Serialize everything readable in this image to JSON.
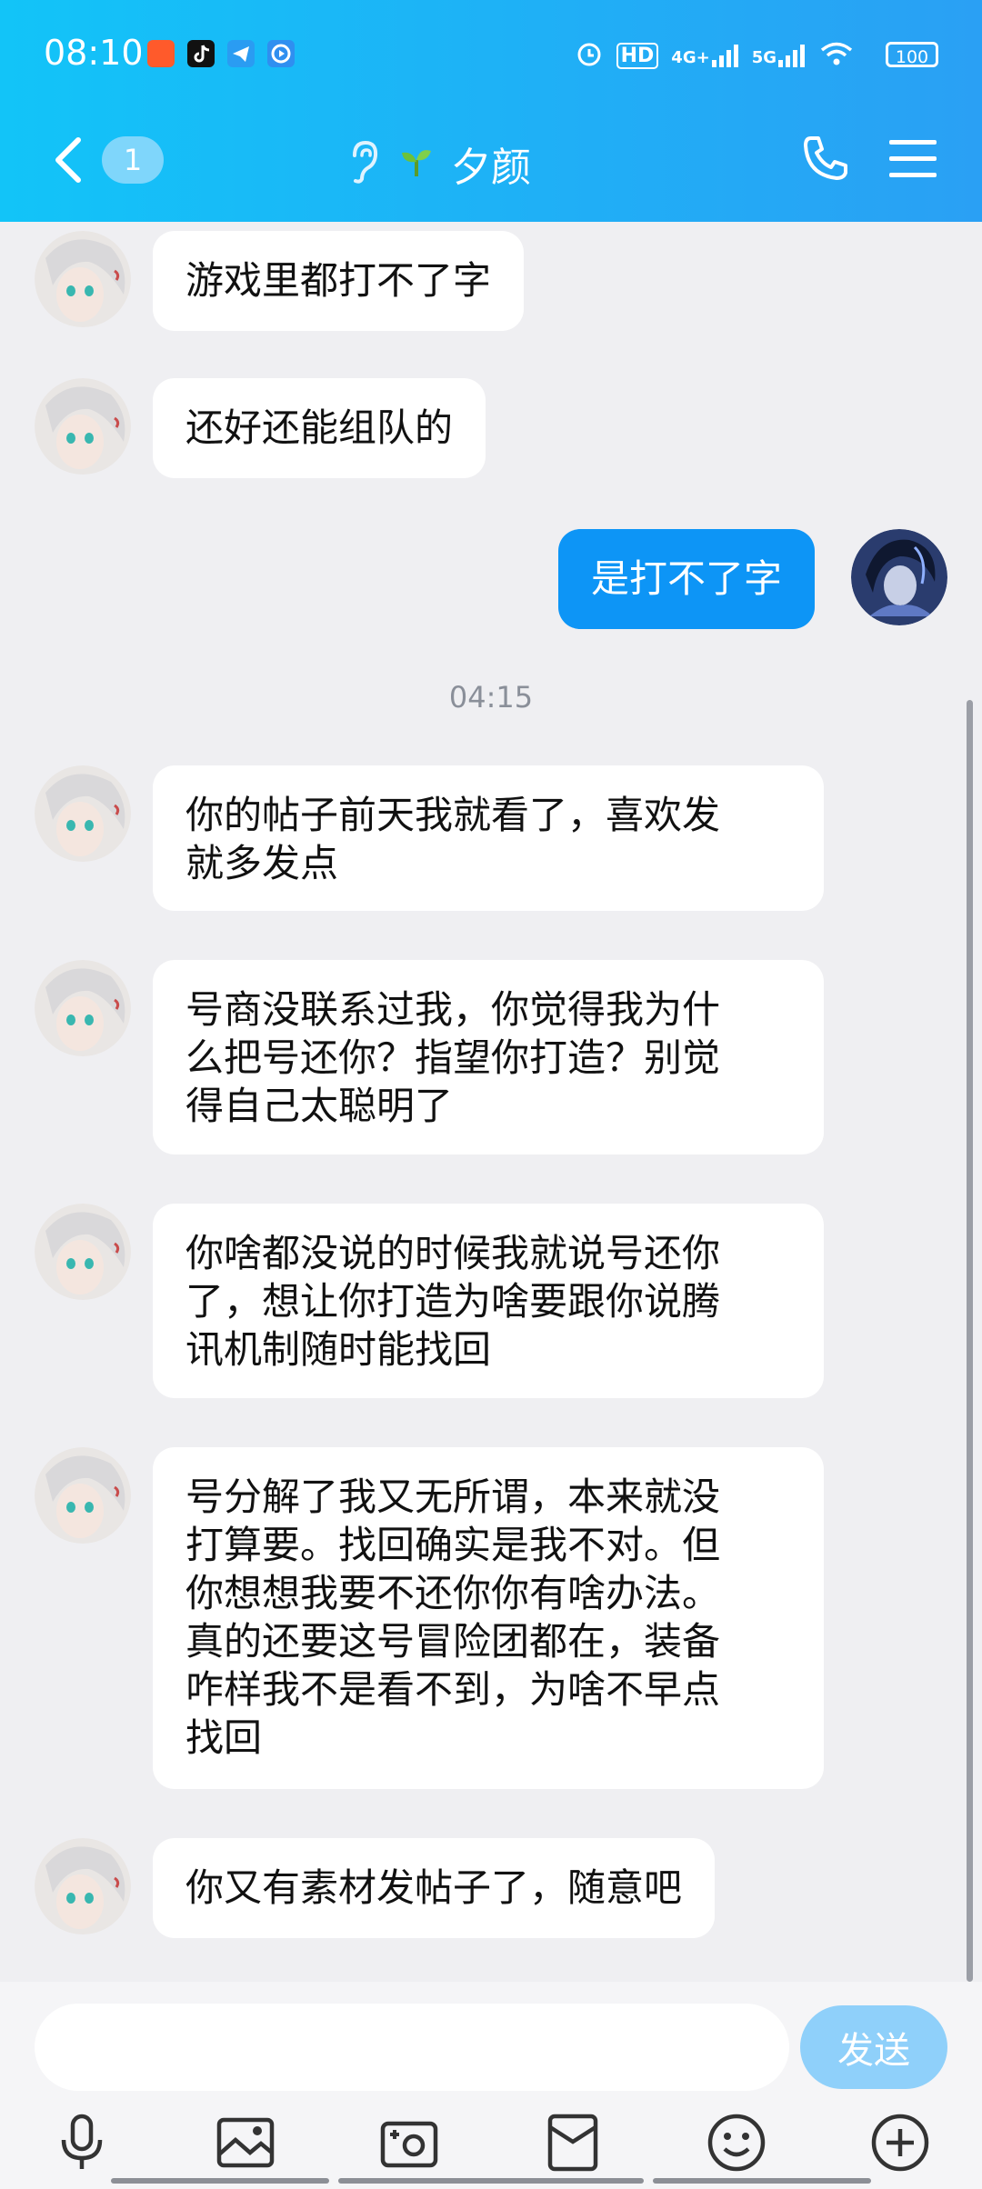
{
  "status_bar": {
    "time": "08:10",
    "network_labels": [
      "HD",
      "4G+",
      "5G"
    ],
    "battery": "100"
  },
  "header": {
    "unread_count": "1",
    "contact_name": "夕颜",
    "colors": {
      "start": "#12c4f8",
      "end": "#2aa0f4"
    }
  },
  "messages": [
    {
      "sender": "other",
      "text": "游戏里都打不了字"
    },
    {
      "sender": "other",
      "text": "还好还能组队的"
    },
    {
      "sender": "self",
      "text": "是打不了字"
    },
    {
      "timestamp": "04:15"
    },
    {
      "sender": "other",
      "text": "你的帖子前天我就看了，喜欢发\n就多发点"
    },
    {
      "sender": "other",
      "text": "号商没联系过我，你觉得我为什\n么把号还你？指望你打造？别觉\n得自己太聪明了"
    },
    {
      "sender": "other",
      "text": "你啥都没说的时候我就说号还你\n了，想让你打造为啥要跟你说腾\n讯机制随时能找回"
    },
    {
      "sender": "other",
      "text": "号分解了我又无所谓，本来就没\n打算要。找回确实是我不对。但\n你想想我要不还你你有啥办法。\n真的还要这号冒险团都在，装备\n咋样我不是看不到，为啥不早点\n找回"
    },
    {
      "sender": "other",
      "text": "你又有素材发帖子了，随意吧"
    }
  ],
  "input": {
    "value": "",
    "send_label": "发送"
  },
  "toolbar": {
    "icons": [
      "microphone-icon",
      "image-icon",
      "camera-icon",
      "red-packet-icon",
      "emoji-icon",
      "plus-icon"
    ]
  },
  "colors": {
    "self_bubble": "#0d95f6",
    "other_bubble": "#ffffff",
    "background": "#efeff2",
    "send_button": "#8fd0fa"
  }
}
